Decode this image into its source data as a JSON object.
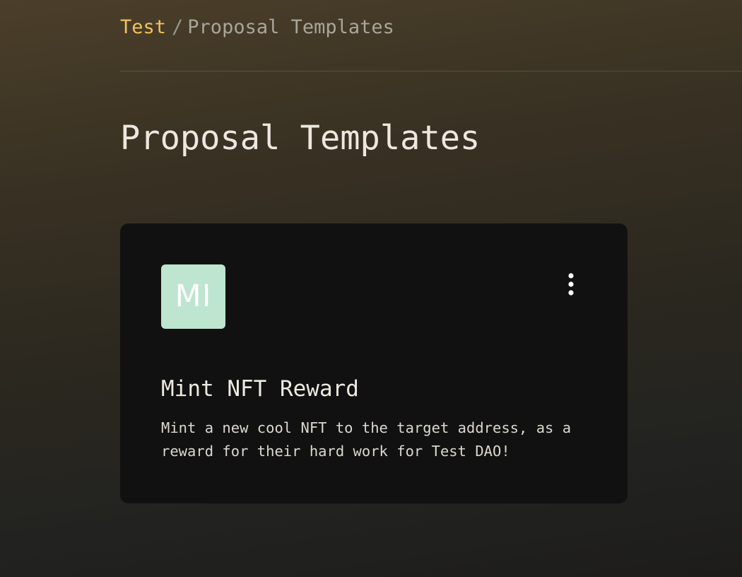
{
  "breadcrumb": {
    "home": "Test",
    "separator": "/",
    "current": "Proposal Templates"
  },
  "page": {
    "title": "Proposal Templates"
  },
  "templates": [
    {
      "avatar_initials": "MI",
      "avatar_color": "#bde5cf",
      "name": "Mint NFT Reward",
      "description": "Mint a new cool NFT to the target address, as a reward for their hard work for Test DAO!",
      "menu_icon": "more-vertical-icon"
    }
  ],
  "colors": {
    "accent": "#f4c15d",
    "card_background": "#111111"
  }
}
